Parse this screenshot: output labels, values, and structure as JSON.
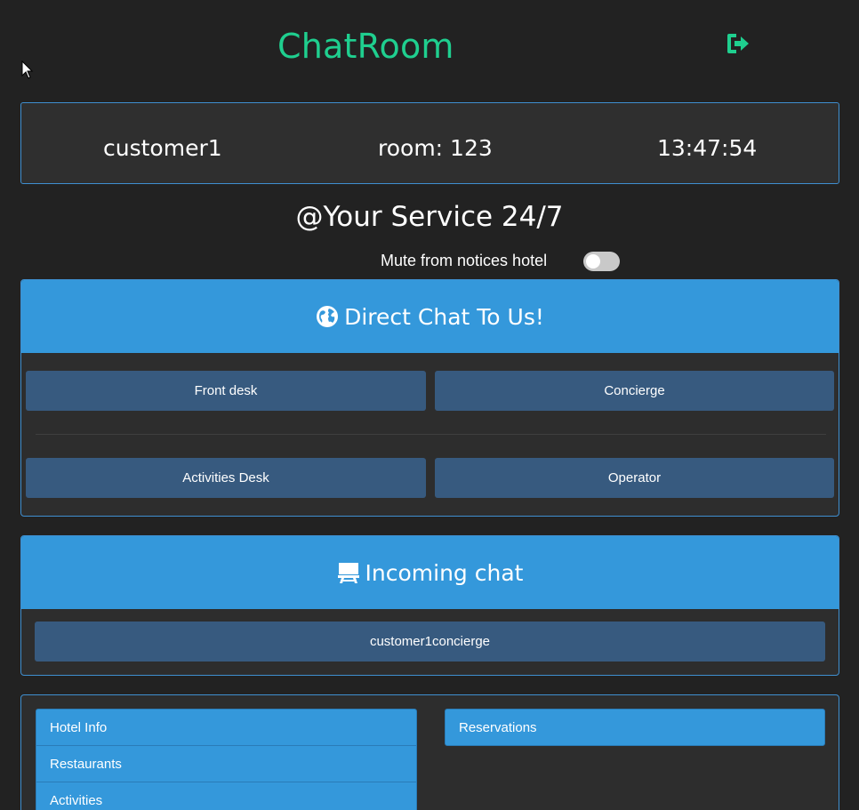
{
  "header": {
    "title": "ChatRoom",
    "logout_icon": "sign-out-icon"
  },
  "info": {
    "username": "customer1",
    "room": "room: 123",
    "time": "13:47:54"
  },
  "service": {
    "title": "@Your Service 24/7",
    "mute_label": "Mute from notices hotel",
    "mute_enabled": false
  },
  "direct_chat": {
    "title": "Direct Chat To Us!",
    "icon": "globe-icon",
    "buttons": [
      "Front desk",
      "Concierge",
      "Activities Desk",
      "Operator"
    ]
  },
  "incoming_chat": {
    "title": "Incoming chat",
    "icon": "desk-icon",
    "chats": [
      "customer1concierge"
    ]
  },
  "menu": {
    "left": [
      "Hotel Info",
      "Restaurants",
      "Activities"
    ],
    "right": [
      "Reservations"
    ]
  },
  "colors": {
    "accent": "#1fcf8f",
    "panel_header": "#3498db",
    "button": "#375a7f",
    "background": "#222222"
  }
}
